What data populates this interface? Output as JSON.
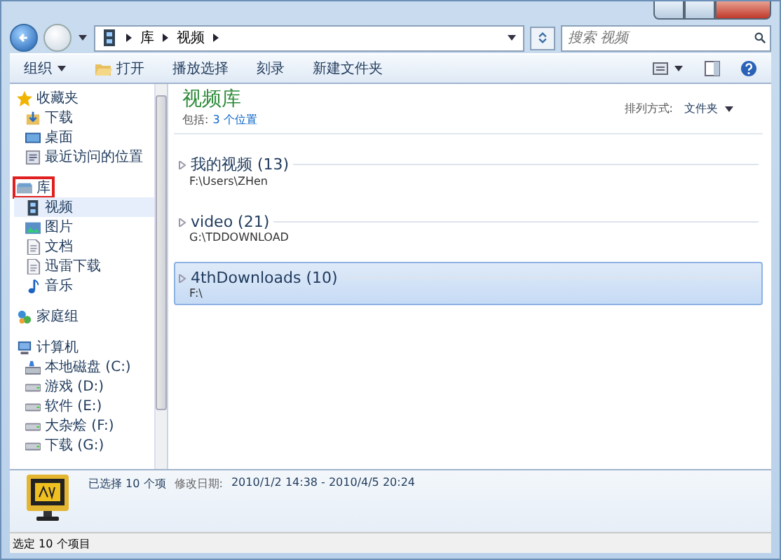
{
  "address": {
    "path": [
      "库",
      "视频"
    ]
  },
  "search": {
    "placeholder": "搜索 视频"
  },
  "toolbar": [
    {
      "label": "组织",
      "kind": "menu"
    },
    {
      "label": "打开",
      "kind": "open"
    },
    {
      "label": "播放选择",
      "kind": "plain"
    },
    {
      "label": "刻录",
      "kind": "plain"
    },
    {
      "label": "新建文件夹",
      "kind": "plain"
    }
  ],
  "sidebar": [
    {
      "label": "收藏夹",
      "kind": "star",
      "highlighted": false,
      "children": [
        {
          "label": "下载",
          "kind": "download",
          "selected": false
        },
        {
          "label": "桌面",
          "kind": "desktop",
          "selected": false
        },
        {
          "label": "最近访问的位置",
          "kind": "recent",
          "selected": false
        }
      ]
    },
    {
      "label": "库",
      "kind": "library",
      "highlighted": true,
      "children": [
        {
          "label": "视频",
          "kind": "video",
          "selected": true
        },
        {
          "label": "图片",
          "kind": "picture",
          "selected": false
        },
        {
          "label": "文档",
          "kind": "document",
          "selected": false
        },
        {
          "label": "迅雷下载",
          "kind": "document",
          "selected": false
        },
        {
          "label": "音乐",
          "kind": "music",
          "selected": false
        }
      ]
    },
    {
      "label": "家庭组",
      "kind": "homegroup",
      "highlighted": false
    },
    {
      "label": "计算机",
      "kind": "computer",
      "highlighted": false,
      "children": [
        {
          "label": "本地磁盘 (C:)",
          "kind": "system-drive",
          "selected": false
        },
        {
          "label": "游戏 (D:)",
          "kind": "drive",
          "selected": false
        },
        {
          "label": "软件 (E:)",
          "kind": "drive",
          "selected": false
        },
        {
          "label": "大杂烩 (F:)",
          "kind": "drive",
          "selected": false
        },
        {
          "label": "下载 (G:)",
          "kind": "drive",
          "selected": false
        }
      ]
    }
  ],
  "library": {
    "title": "视频库",
    "includes_label": "包括:",
    "includes_link": "3 个位置",
    "arrange_label": "排列方式:",
    "arrange_value": "文件夹"
  },
  "folders": [
    {
      "name": "我的视频 (13)",
      "path": "F:\\Users\\ZHen",
      "selected": false
    },
    {
      "name": "video (21)",
      "path": "G:\\TDDOWNLOAD",
      "selected": false
    },
    {
      "name": "4thDownloads (10)",
      "path": "F:\\",
      "selected": true
    }
  ],
  "details": {
    "selected": "已选择 10 个项",
    "date_label": "修改日期:",
    "date_value": "2010/1/2 14:38 - 2010/4/5 20:24"
  },
  "status_bar": "选定 10 个项目"
}
